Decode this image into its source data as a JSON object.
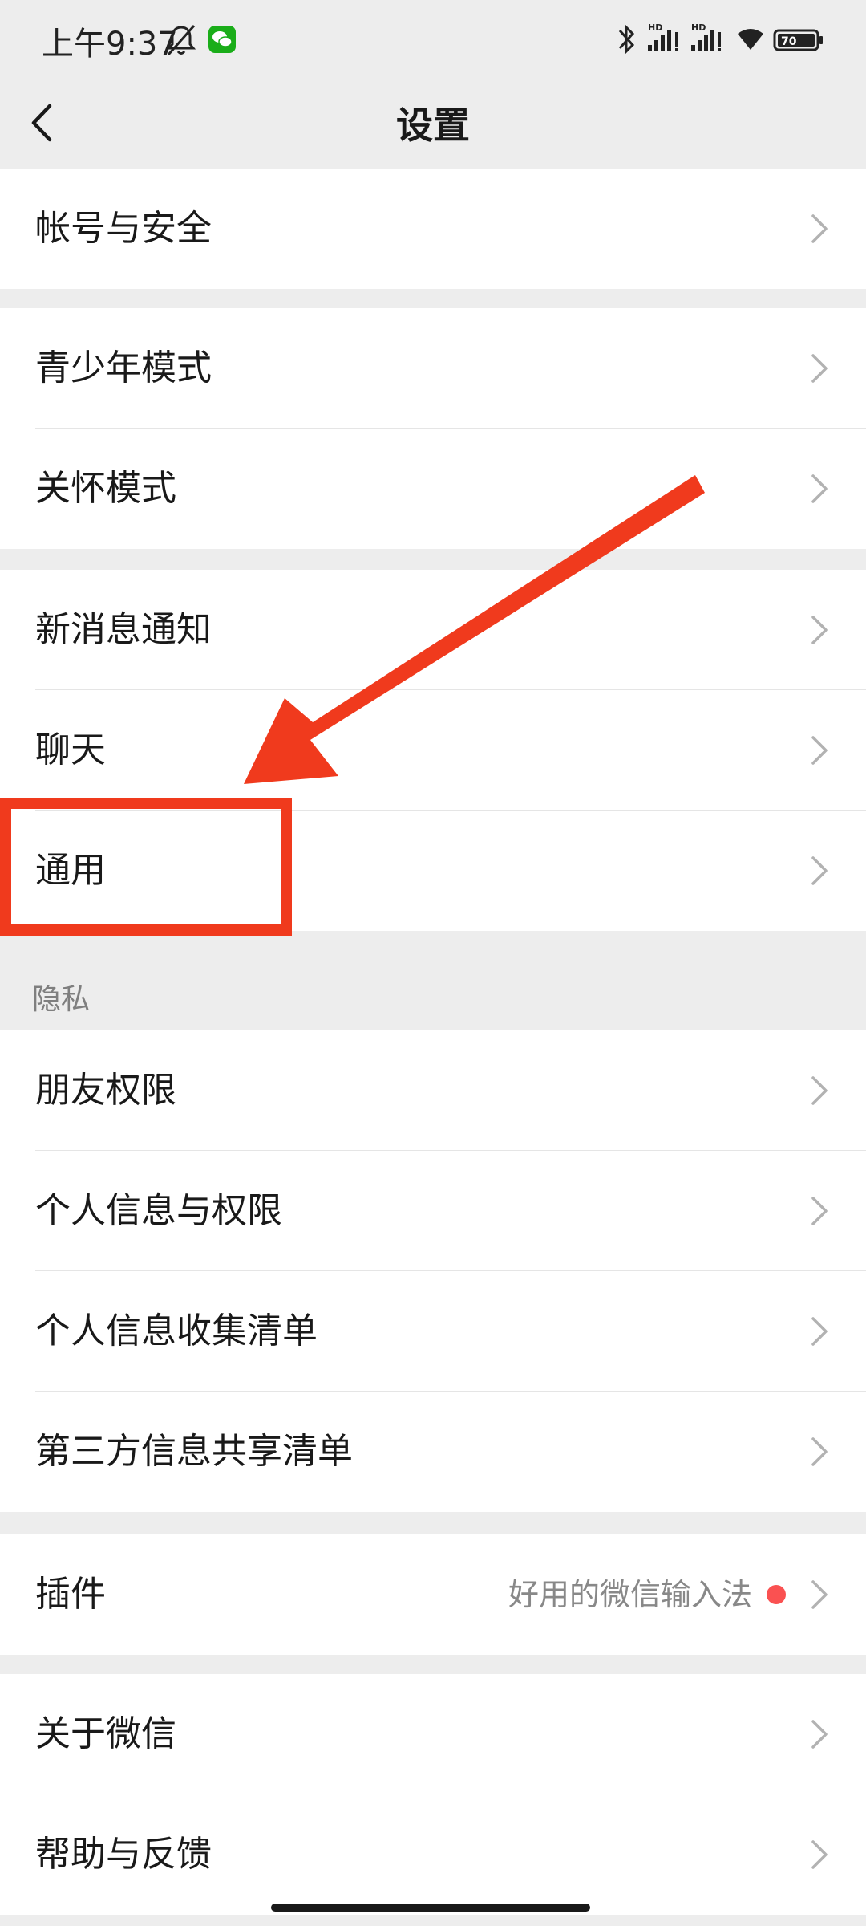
{
  "status_bar": {
    "time": "上午9:37",
    "icons": [
      "bell-off-icon",
      "wechat-icon",
      "bluetooth-icon",
      "signal-hd-icon",
      "signal-hd-icon",
      "wifi-icon",
      "battery-icon"
    ],
    "signal_label_1": "HD",
    "signal_label_2": "HD",
    "battery": "70"
  },
  "header": {
    "title": "设置",
    "back_icon": "chevron-left-icon"
  },
  "groups": [
    {
      "items": [
        {
          "label": "帐号与安全"
        }
      ]
    },
    {
      "items": [
        {
          "label": "青少年模式"
        },
        {
          "label": "关怀模式"
        }
      ]
    },
    {
      "items": [
        {
          "label": "新消息通知"
        },
        {
          "label": "聊天"
        },
        {
          "label": "通用"
        }
      ]
    },
    {
      "section_title": "隐私",
      "items": [
        {
          "label": "朋友权限"
        },
        {
          "label": "个人信息与权限"
        },
        {
          "label": "个人信息收集清单"
        },
        {
          "label": "第三方信息共享清单"
        }
      ]
    },
    {
      "items": [
        {
          "label": "插件",
          "hint": "好用的微信输入法",
          "badge": "red-dot"
        }
      ]
    },
    {
      "items": [
        {
          "label": "关于微信"
        },
        {
          "label": "帮助与反馈"
        }
      ]
    }
  ],
  "colors": {
    "background": "#ededed",
    "cell": "#ffffff",
    "annotation": "#f03a1d",
    "badge": "#fa5151"
  }
}
